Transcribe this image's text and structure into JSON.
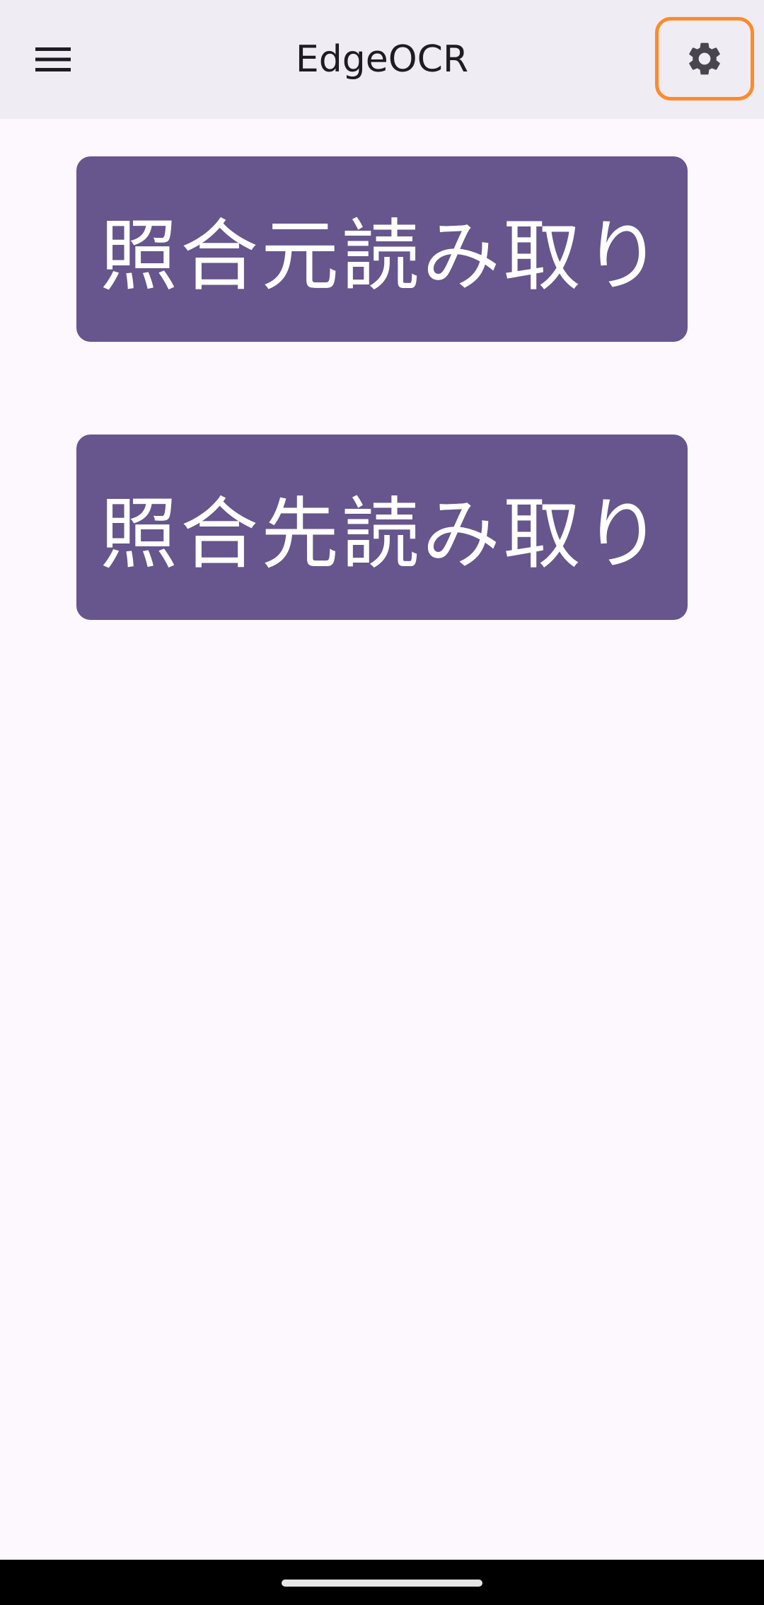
{
  "app_bar": {
    "title": "EdgeOCR",
    "menu_icon": "hamburger-menu-icon",
    "settings_icon": "gear-icon"
  },
  "actions": {
    "read_source_label": "照合元読み取り",
    "read_target_label": "照合先読み取り"
  },
  "colors": {
    "background": "#FDF7FE",
    "app_bar": "#F0ECF3",
    "button": "#67558D",
    "button_text": "#FFFFFF",
    "highlight": "#FF8A2B",
    "icon": "#49454F"
  }
}
